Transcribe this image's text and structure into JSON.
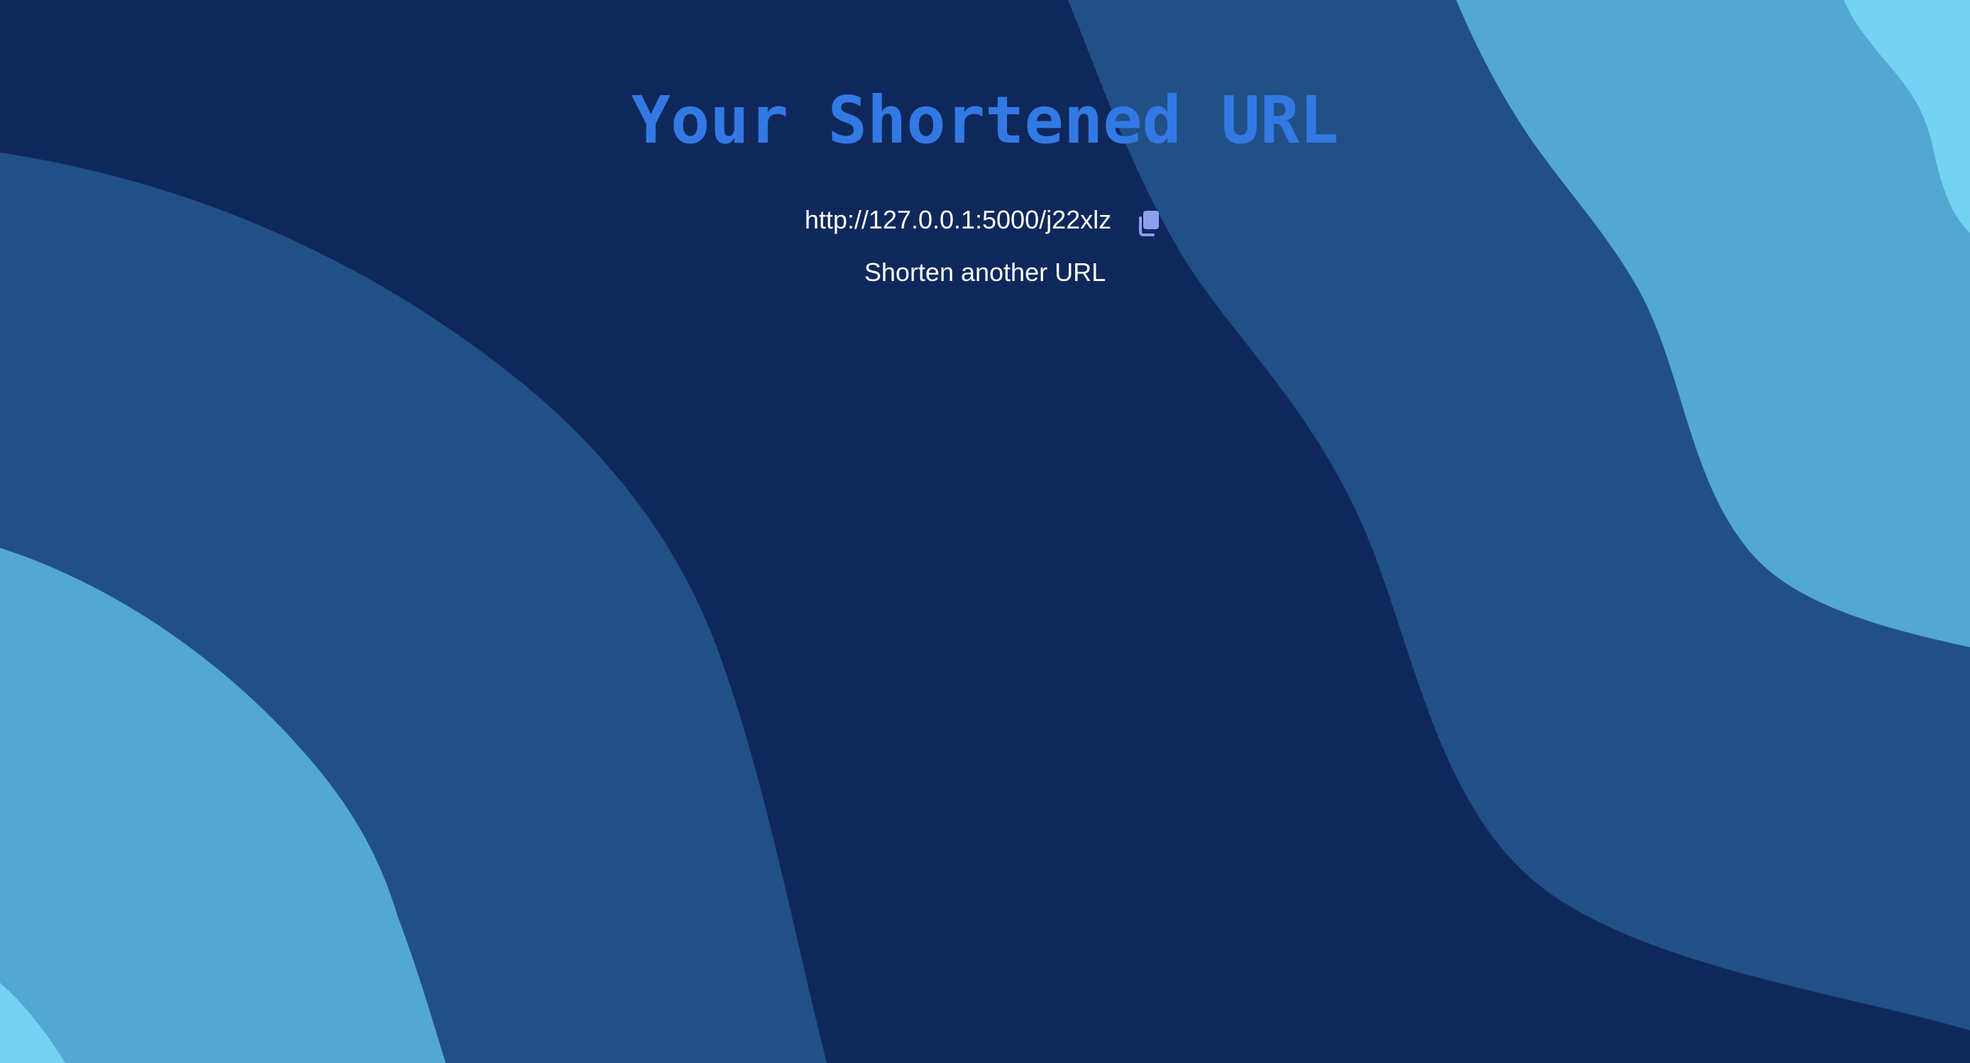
{
  "page": {
    "title": "Your Shortened URL"
  },
  "result": {
    "short_url": "http://127.0.0.1:5000/j22xlz",
    "copy_icon": "copy-icon"
  },
  "actions": {
    "shorten_another_label": "Shorten another URL"
  },
  "colors": {
    "background": "#0f285c",
    "wave_mid": "#215087",
    "wave_light": "#52a7d3",
    "wave_lightest": "#75d3f2",
    "title": "#3379e4",
    "icon": "#8c9fee",
    "text": "#ffffff"
  }
}
